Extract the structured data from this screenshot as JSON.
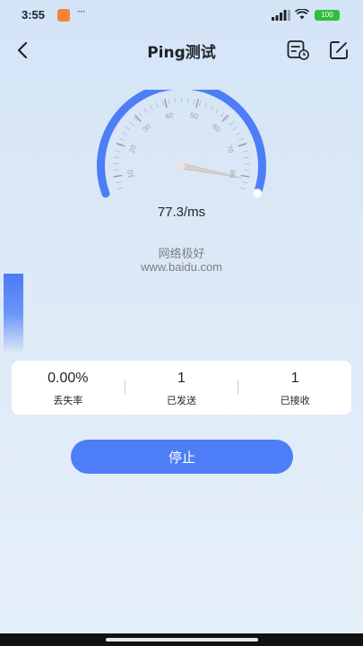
{
  "status_bar": {
    "time": "3:55",
    "more": "···",
    "battery_label": "100"
  },
  "nav": {
    "title": "Ping测试"
  },
  "gauge": {
    "ticks": [
      "10",
      "20",
      "30",
      "40",
      "50",
      "60",
      "70",
      "80"
    ],
    "needle_fraction": 0.96,
    "track_color": "#4d7ef7",
    "needle_color": "#d9cfc4"
  },
  "result": {
    "ping_value": "77.3/ms",
    "network_status": "网络极好",
    "host": "www.baidu.com"
  },
  "stats": [
    {
      "value": "0.00%",
      "label": "丢失率"
    },
    {
      "value": "1",
      "label": "已发送"
    },
    {
      "value": "1",
      "label": "已接收"
    }
  ],
  "actions": {
    "stop_label": "停止"
  },
  "colors": {
    "accent": "#4d7ef7",
    "battery": "#2fbf3a"
  }
}
